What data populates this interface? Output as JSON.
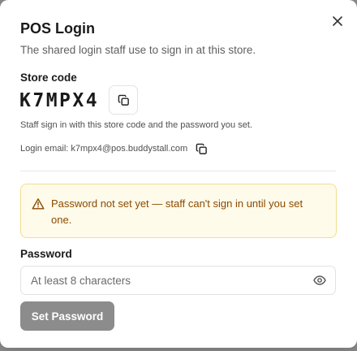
{
  "dialog": {
    "title": "POS Login",
    "subtitle": "The shared login staff use to sign in at this store."
  },
  "store": {
    "label": "Store code",
    "code": "K7MPX4",
    "helper": "Staff sign in with this store code and the password you set.",
    "login_email_text": "Login email: k7mpx4@pos.buddystall.com"
  },
  "warning": {
    "text": "Password not set yet — staff can't sign in until you set one."
  },
  "password": {
    "label": "Password",
    "value": "",
    "placeholder": "At least 8 characters"
  },
  "actions": {
    "set_password_label": "Set Password"
  },
  "icons": {
    "close": "close-icon",
    "copy_code": "copy-icon",
    "copy_email": "copy-icon",
    "warning": "alert-triangle-icon",
    "show_password": "eye-icon"
  },
  "colors": {
    "warning_background": "#fffbea",
    "warning_border": "#f2dd8e",
    "warning_text": "#8a4a00",
    "button_disabled": "#8c8c8c"
  }
}
